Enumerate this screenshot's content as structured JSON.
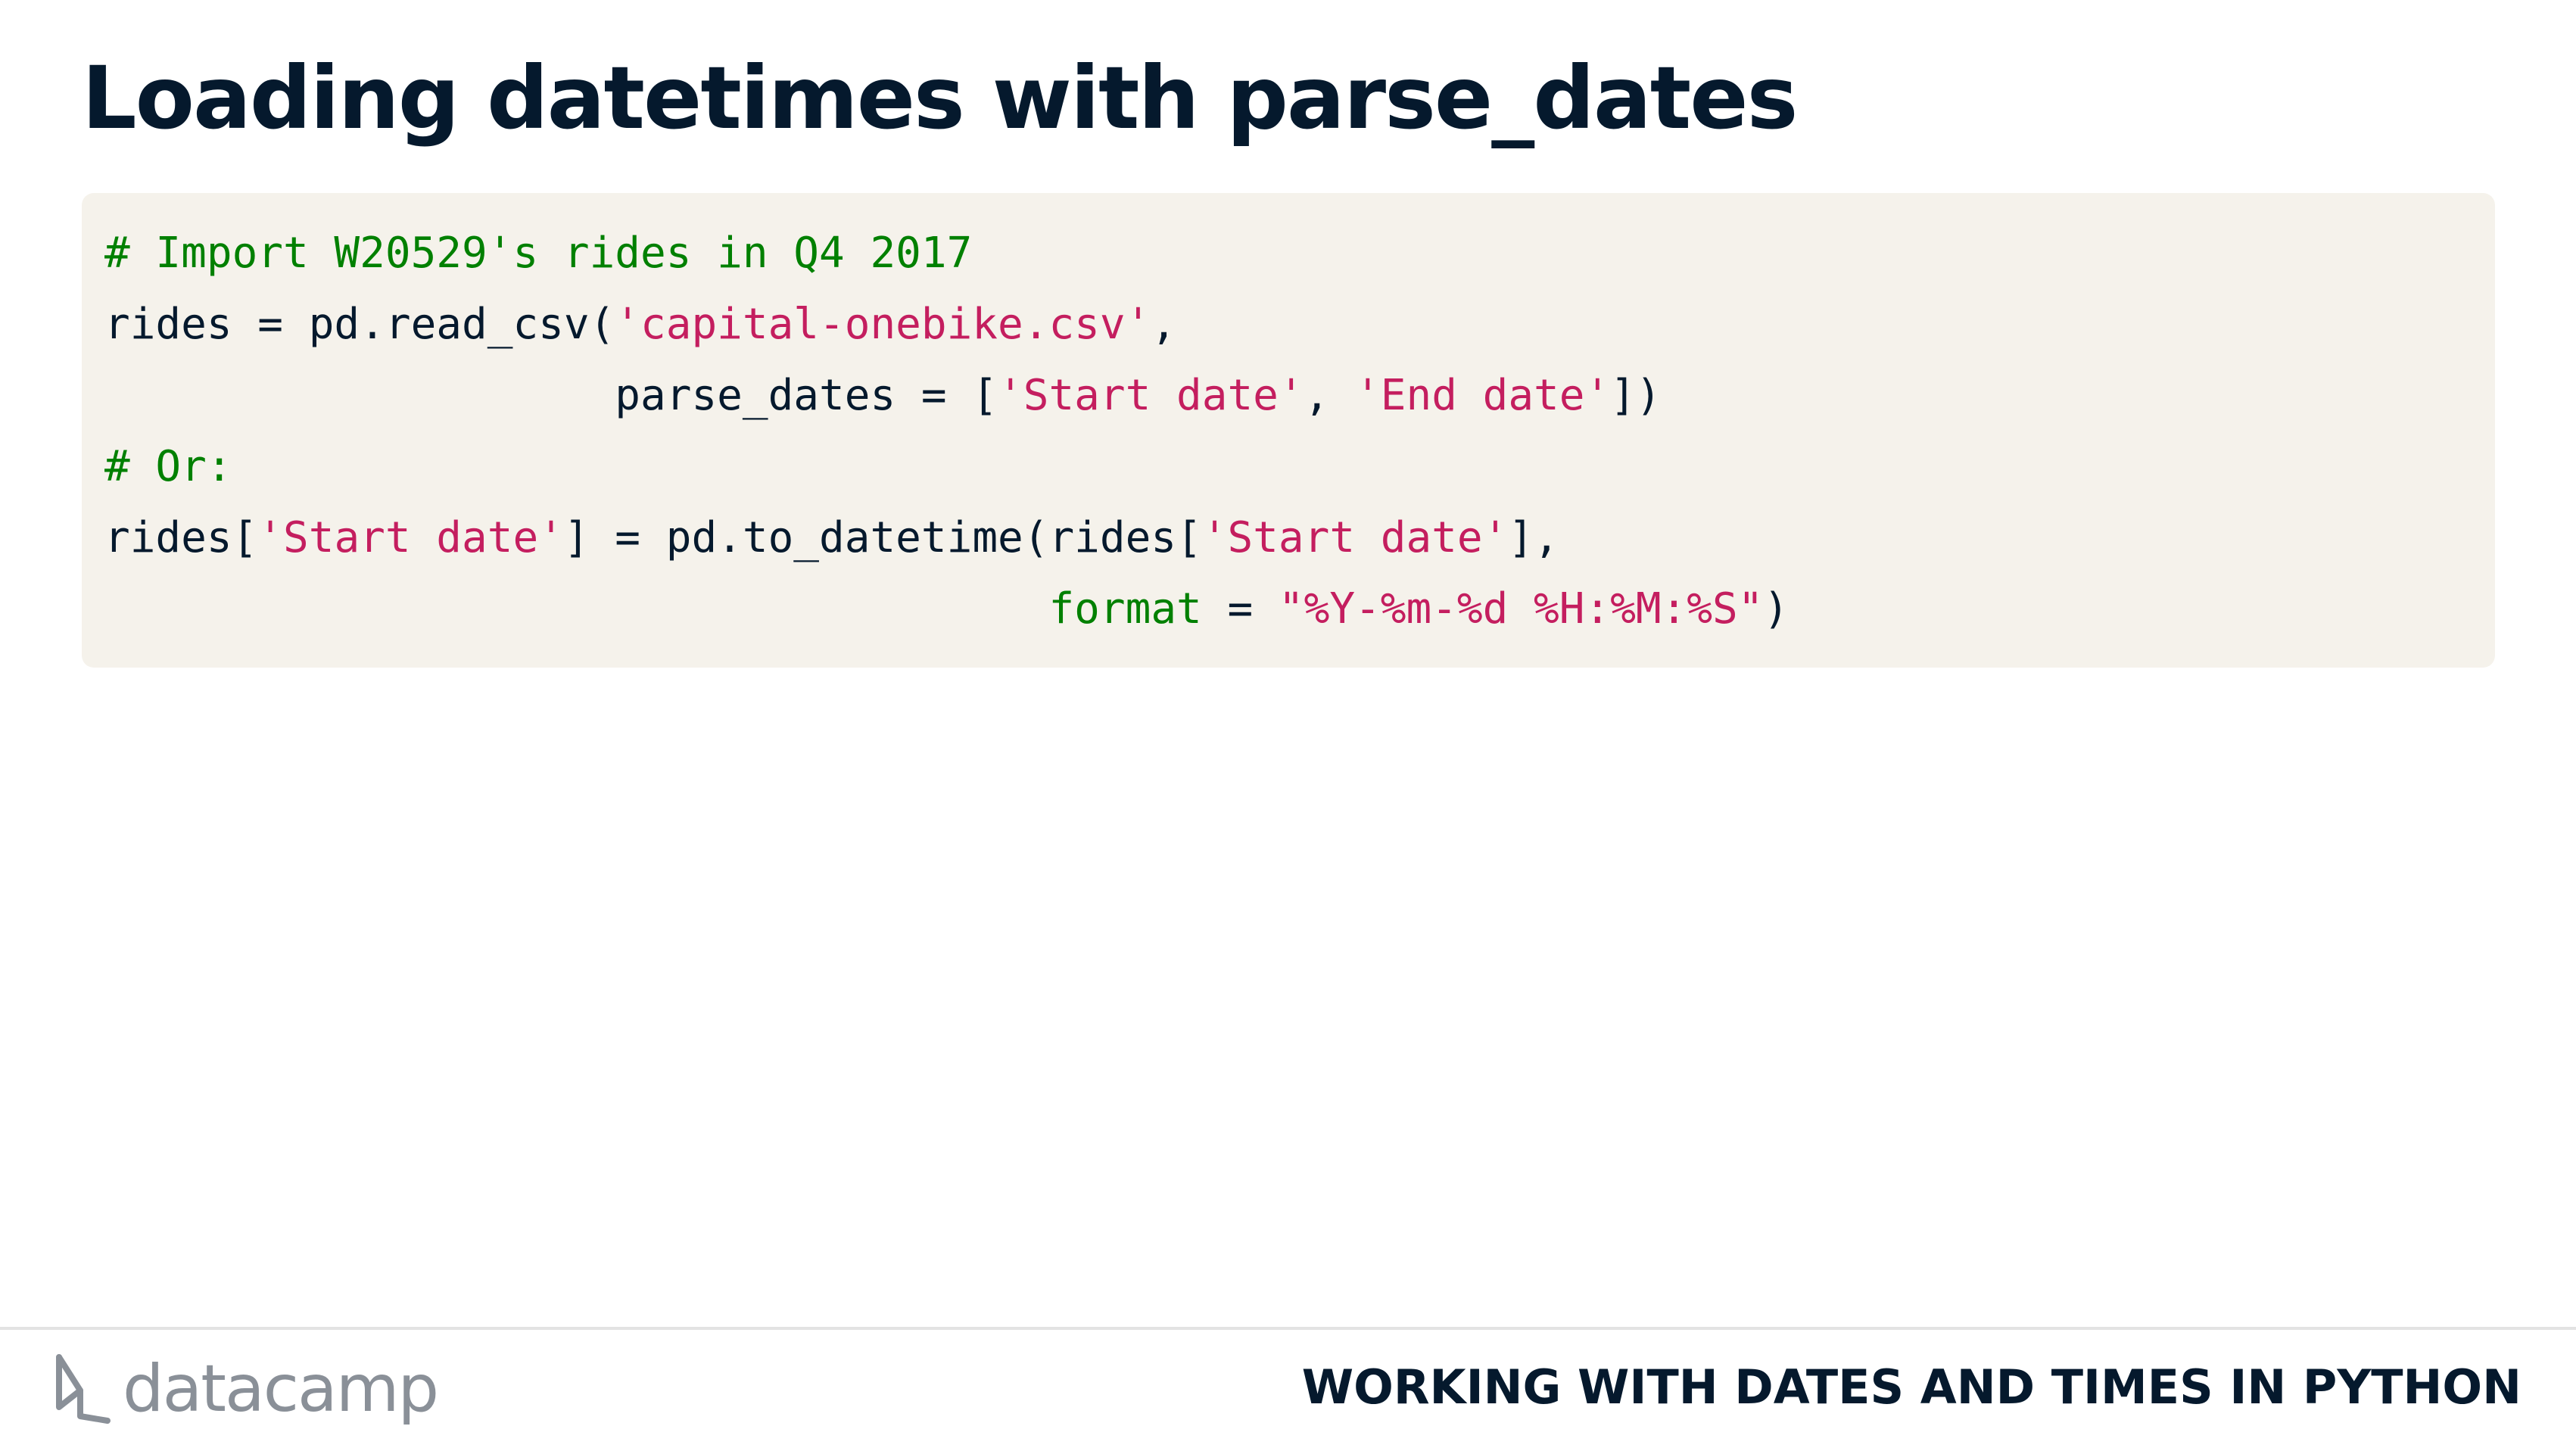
{
  "slide": {
    "title": "Loading datetimes with parse_dates"
  },
  "code": {
    "line1": {
      "comment": "# Import W20529's rides in Q4 2017"
    },
    "line2": {
      "prefix": "rides = pd.read_csv(",
      "str": "'capital-onebike.csv'",
      "suffix": ","
    },
    "line3": {
      "indent": "                    ",
      "prefix": "parse_dates = [",
      "str1": "'Start date'",
      "sep": ", ",
      "str2": "'End date'",
      "suffix": "])"
    },
    "line4": {
      "comment": "# Or:"
    },
    "line5": {
      "prefix": "rides[",
      "str1": "'Start date'",
      "mid": "] = pd.to_datetime(rides[",
      "str2": "'Start date'",
      "suffix": "],"
    },
    "line6": {
      "indent": "                                     ",
      "kw": "format",
      "eq": " = ",
      "str": "\"%Y-%m-%d %H:%M:%S\"",
      "suffix": ")"
    }
  },
  "footer": {
    "brand_icon": "datacamp-logo-icon",
    "brand_name": "datacamp",
    "course_name": "WORKING WITH DATES AND TIMES IN PYTHON"
  },
  "colors": {
    "title": "#05192d",
    "code_background": "#f5f2eb",
    "comment": "#008000",
    "string": "#c41e5f",
    "brand": "#8a9098"
  }
}
